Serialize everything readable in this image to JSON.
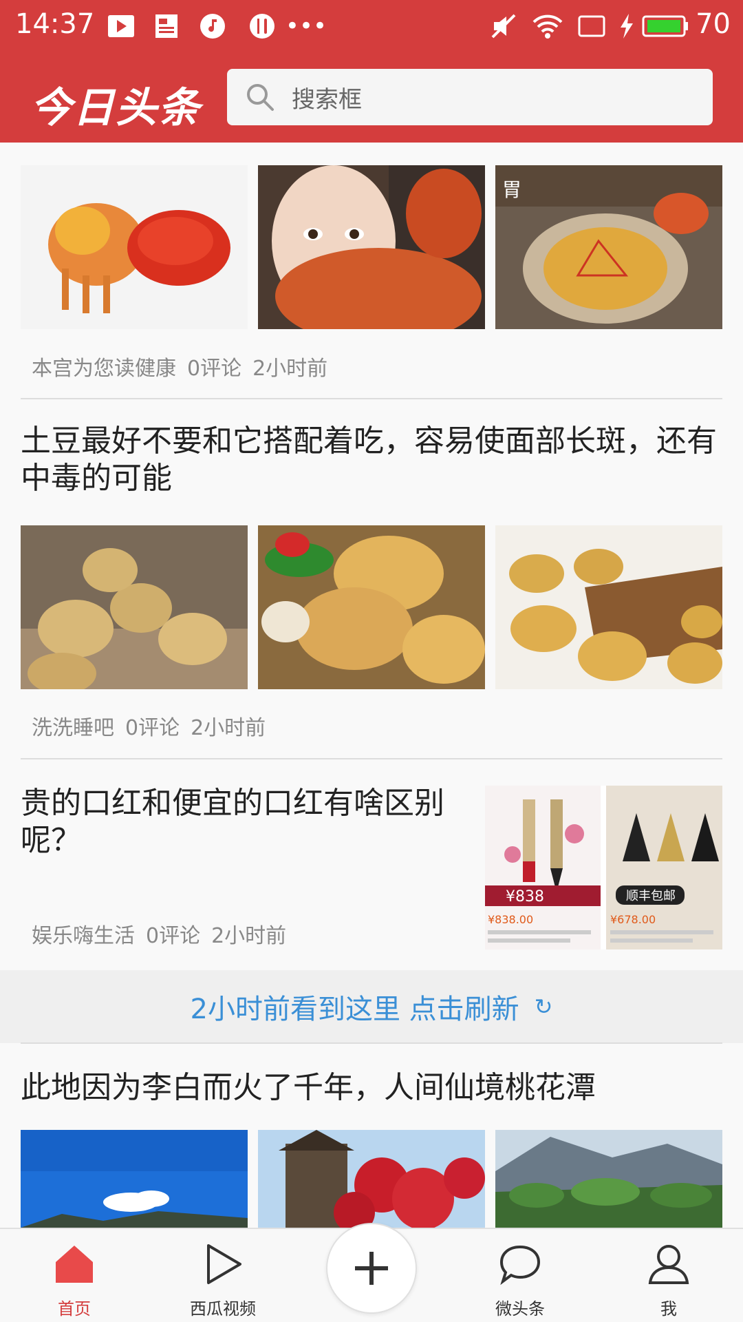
{
  "status_bar": {
    "time": "14:37",
    "battery": "70"
  },
  "header": {
    "logo": "今日头条",
    "search_placeholder": "搜索框"
  },
  "articles": [
    {
      "title": "",
      "source": "本宫为您读健康",
      "comments": "0评论",
      "time": "2小时前"
    },
    {
      "title": "土豆最好不要和它搭配着吃，容易使面部长斑，还有中毒的可能",
      "source": "洗洗睡吧",
      "comments": "0评论",
      "time": "2小时前"
    },
    {
      "title": "贵的口红和便宜的口红有啥区别呢？",
      "source": "娱乐嗨生活",
      "comments": "0评论",
      "time": "2小时前"
    },
    {
      "title": "此地因为李白而火了千年，人间仙境桃花潭"
    }
  ],
  "refresh": {
    "text": "2小时前看到这里 点击刷新"
  },
  "bottom_nav": {
    "home": "首页",
    "video": "西瓜视频",
    "weitoutiao": "微头条",
    "me": "我"
  },
  "colors": {
    "brand": "#d43d3d",
    "link": "#3a8fd6"
  }
}
